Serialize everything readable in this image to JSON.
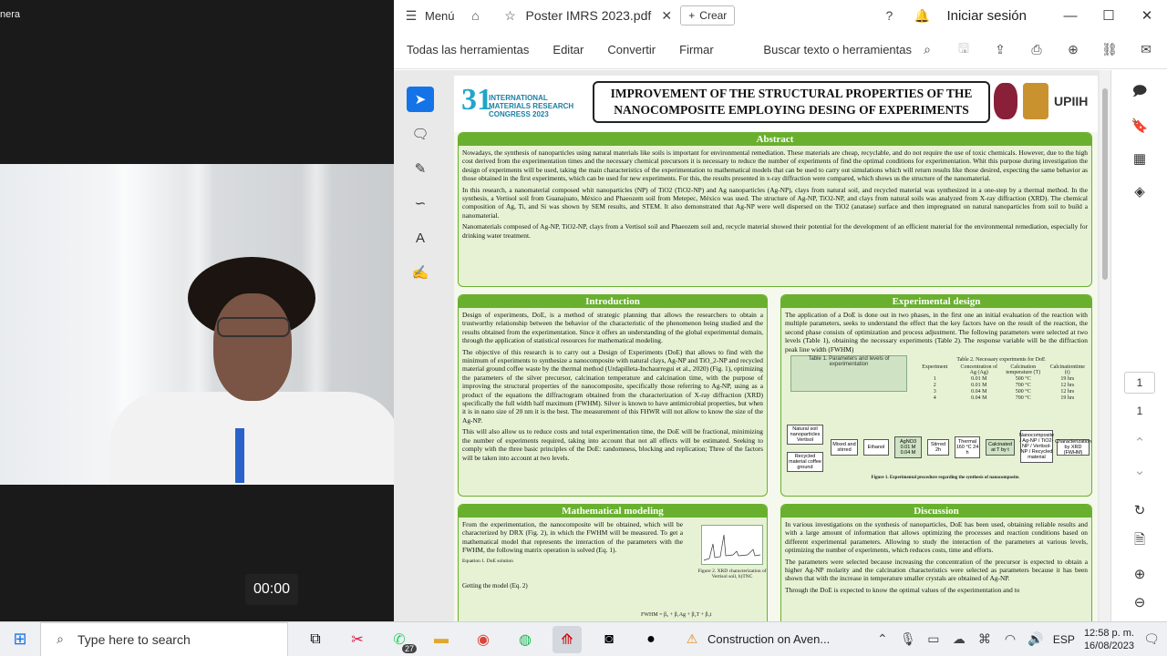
{
  "video": {
    "label": "nera",
    "timer": "00:00"
  },
  "titlebar": {
    "menu_label": "Menú",
    "tab_name": "Poster IMRS 2023.pdf",
    "create_label": "Crear",
    "signin_label": "Iniciar sesión"
  },
  "toolbar": {
    "all_tools": "Todas las herramientas",
    "edit": "Editar",
    "convert": "Convertir",
    "sign": "Firmar",
    "search_tools": "Buscar texto o herramientas"
  },
  "right_rail": {
    "page_current": "1",
    "page_total": "1"
  },
  "poster": {
    "logo_number": "31",
    "logo_text": "INTERNATIONAL MATERIALS RESEARCH CONGRESS 2023",
    "title": "IMPROVEMENT OF THE STRUCTURAL PROPERTIES OF THE NANOCOMPOSITE EMPLOYING DESING OF EXPERIMENTS",
    "institution": "UPIIH",
    "abstract": {
      "heading": "Abstract",
      "p1": "Nowadays, the synthesis of nanoparticles using natural materials like soils is important for environmental remediation. These materials are cheap, recyclable, and do not require the use of toxic chemicals. However, due to the high cost derived from the experimentation times and the necessary chemical precursors it is necessary to reduce the number of experiments of find the optimal conditions for experimentation. Whit this purpose during investigation the design of experiments will be used, taking the main characteristics of the experimentation to mathematical models that can be used to carry out simulations which will return results like those desired, expecting the same behavior as those obtained in the first experiments, which can be used for new experiments. For this, the results presented in x-ray diffraction were compared, which shows us the structure of the nanomaterial.",
      "p2": "In this research, a nanomaterial composed whit nanoparticles (NP) of TiO2 (TiO2-NP) and Ag nanoparticles (Ag-NP), clays from natural soil, and recycled material was synthesized in a one-step by a thermal method. In the synthesis, a Vertisol soil from Guanajuato, México and Phaeozem soil from Metepec, México was used. The structure of Ag-NP, TiO2-NP, and clays from natural soils was analyzed from X-ray diffraction (XRD). The chemical composition of Ag, Ti, and Si was shown by SEM results, and STEM. It also demonstrated that Ag-NP were well dispersed on the TiO2 (anatase) surface and then impregnated on natural nanoparticles from soil to build a nanomaterial.",
      "p3": "Nanomaterials composed of Ag-NP, TiO2-NP, clays from a Vertisol soil and Phaeozem soil and, recycle material showed their potential for the development of an efficient material for the environmental remediation, especially for drinking water treatment."
    },
    "introduction": {
      "heading": "Introduction",
      "p1": "Design of experiments, DoE, is a method of strategic planning that allows the researchers to obtain a trustworthy relationship between the behavior of the characteristic of the phenomenon being studied and the results obtained from the experimentation. Since it offers an understanding of the global experimental domain, through the application of statistical resources for mathematical modeling.",
      "p2": "The objective of this research is to carry out a Design of Experiments (DoE) that allows to find with the minimum of experiments to synthesize a nanocomposite with natural clays, Ag-NP and TiO_2-NP and recycled material ground coffee waste by the thermal method (Urdapilleta-Inchaurregui et al., 2020) (Fig. 1), optimizing the parameters of the silver precursor, calcination temperature and calcination time, with the purpose of improving the structural properties of the nanocomposite, specifically those referring to Ag-NP, using as a product of the equations the diffractogram obtained from the characterization of X-ray diffraction (XRD) specifically the full width half maximum (FWHM). Silver is known to have antimicrobial properties, but when it is in nano size of 20 nm it is the best. The measurement of this FHWR will not allow to know the size of the Ag-NP.",
      "p3": "This will also allow us to reduce costs and total experimentation time, the DoE will be fractional, minimizing the number of experiments required, taking into account that not all effects will be estimated. Seeking to comply with the three basic principles of the DoE: randomness, blocking and replication; Three of the factors will be taken into account at two levels."
    },
    "experimental": {
      "heading": "Experimental design",
      "p1": "The application of a DoE is done out in two phases, in the first one an initial evaluation of the reaction with multiple parameters, seeks to understand the effect that the key factors have on the result of the reaction, the second phase consists of optimization and process adjustment. The following parameters were selected at two levels (Table 1), obtaining the necessary experiments (Table 2). The response variable will be the diffraction peak line width (FWHM)",
      "table1_title": "Table 1. Parameters and levels of experimentation",
      "table2_title": "Table 2. Necessary experiments for DoE",
      "table2_headers": [
        "Experiment",
        "Concentration of Ag (Ag)",
        "Calcination temperature (T)",
        "Calcinationtime (t)"
      ],
      "table2_rows": [
        [
          "1",
          "0.01 M",
          "500 °C",
          "19 hrs"
        ],
        [
          "2",
          "0.01 M",
          "700 °C",
          "12 hrs"
        ],
        [
          "3",
          "0.04 M",
          "500 °C",
          "12 hrs"
        ],
        [
          "4",
          "0.04 M",
          "700 °C",
          "19 hrs"
        ]
      ],
      "flow_steps": [
        "Natural soil nanoparticles Vertisol",
        "Recycled material coffee ground",
        "Mixed and stirred",
        "Ethanol",
        "AgNO3 0.01 M 0.04 M",
        "Stirred 2h",
        "Thermal 160 °C 24 h",
        "Calcinated at T by t",
        "Nanocomposite / Ag-NP / TiO2-NP / Vertisol-NP / Recycled material",
        "Characterization by XRD (FWHM)"
      ],
      "figure_caption": "Figure 1. Experimental procedure regarding the synthesis of nanocomposite."
    },
    "math": {
      "heading": "Mathematical modeling",
      "p1": "From the experimentation, the nanocomposite will be obtained, which will be characterized by DRX (Fig. 2), in which the FWHM will be measured. To get a mathematical model that represents the interaction of the parameters with the FWHM, the following matrix operation is solved (Eq. 1).",
      "eq_label": "Equation 1. DoE solution",
      "figure_caption": "Figure 2. XRD characterization of Vertisol soil, b)TNC",
      "getting_model": "Getting the model (Eq. 2)",
      "eq2": "FWHM = β₀ + β₁Ag + β₂T + β₃t"
    },
    "discussion": {
      "heading": "Discussion",
      "p1": "In various investigations on the synthesis of nanoparticles, DoE has been used, obtaining reliable results and with a large amount of information that allows optimizing the processes and reaction conditions based on different experimental parameters. Allowing to study the interaction of the parameters at various levels, optimizing the number of experiments, which reduces costs, time and efforts.",
      "p2": "The parameters were selected because increasing the concentration of the precursor is expected to obtain a higher Ag-NP molarity and the calcination characteristics were selected as parameters because it has been shown that with the increase in temperature smaller crystals are obtained of Ag-NP.",
      "p3": "Through the DoE is expected to know the optimal values of the experimentation and to"
    }
  },
  "taskbar": {
    "search_placeholder": "Type here to search",
    "whatsapp_badge": "27",
    "tray_app_label": "Construction on Aven...",
    "language": "ESP",
    "time": "12:58 p. m.",
    "date": "16/08/2023"
  }
}
